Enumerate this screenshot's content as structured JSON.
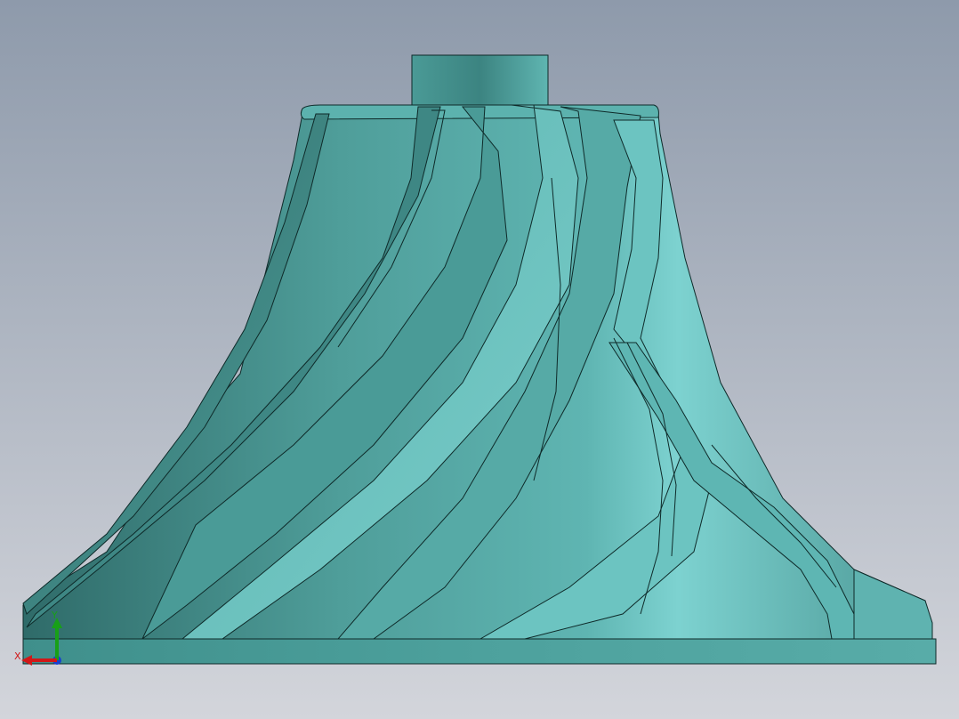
{
  "viewport": {
    "background_top": "#8e9aab",
    "background_bottom": "#d3d5db"
  },
  "model": {
    "name": "impeller",
    "fill_dark": "#2f6b69",
    "fill_mid": "#4d9f9b",
    "fill_light": "#7dd2d0",
    "edge_color": "#0e2a29"
  },
  "triad": {
    "x_label": "X",
    "y_label": "Y",
    "x_color": "#d01818",
    "y_color": "#18a018",
    "z_color": "#1840d0"
  }
}
